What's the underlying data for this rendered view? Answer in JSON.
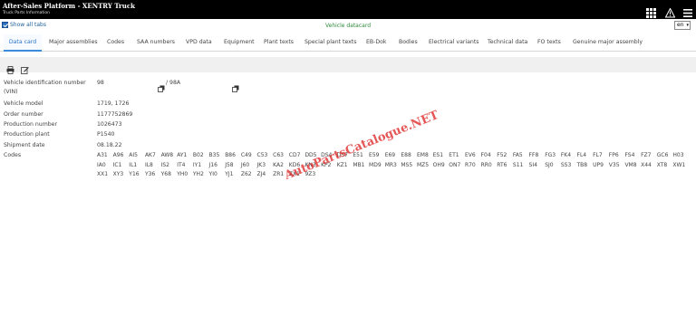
{
  "header": {
    "title": "After-Sales Platform - XENTRY Truck",
    "subtitle": "Truck Parts Information",
    "icons": [
      "grid-icon",
      "warning-icon",
      "menu-icon"
    ]
  },
  "subbar": {
    "show_all_tabs": "Show all tabs",
    "center_title": "Vehicle datacard",
    "language": "en"
  },
  "tabs": [
    {
      "label": "Data card",
      "active": true
    },
    {
      "label": "Major assemblies"
    },
    {
      "label": "Codes"
    },
    {
      "label": "SAA numbers"
    },
    {
      "label": "VPD data"
    },
    {
      "label": "Equipment"
    },
    {
      "label": "Plant texts"
    },
    {
      "label": "Special plant texts"
    },
    {
      "label": "EB-Dok"
    },
    {
      "label": "Bodies"
    },
    {
      "label": "Electrical variants"
    },
    {
      "label": "Technical data"
    },
    {
      "label": "FO texts"
    },
    {
      "label": "Genuine major assembly"
    }
  ],
  "toolbar": {
    "icons": [
      "print-icon",
      "edit-icon"
    ]
  },
  "details": {
    "vin_label_1": "Vehicle identification number",
    "vin_label_2": "(VIN)",
    "vin_value": "98",
    "vin_value_2": "/ 98A",
    "model_label": "Vehicle model",
    "model_value": "1719, 1726",
    "order_label": "Order number",
    "order_value": "1177752869",
    "prodnum_label": "Production number",
    "prodnum_value": "1026473",
    "plant_label": "Production plant",
    "plant_value": "P1540",
    "ship_label": "Shipment date",
    "ship_value": "08.18.22",
    "codes_label": "Codes"
  },
  "codes": [
    [
      "A31",
      "A96",
      "AI5",
      "AK7",
      "AW8",
      "AY1",
      "B02",
      "B35",
      "B86",
      "C49",
      "C53",
      "C63",
      "CD7",
      "DD5",
      "DS4",
      "DS7",
      "E51",
      "E59",
      "E69",
      "E88",
      "EM8",
      "ES1",
      "ET1",
      "EV6",
      "F04",
      "F52",
      "FA5",
      "FF8",
      "FG3",
      "FK4",
      "FL4",
      "FL7",
      "FP6",
      "FS4",
      "FZ7",
      "GC6",
      "H03"
    ],
    [
      "IA0",
      "IC1",
      "IL1",
      "IL8",
      "IS2",
      "IT4",
      "IY1",
      "J16",
      "J58",
      "J60",
      "JK3",
      "KA2",
      "KD6",
      "KN3",
      "KP2",
      "KZ1",
      "MB1",
      "MD9",
      "MR3",
      "MS5",
      "MZ5",
      "OH9",
      "ON7",
      "R70",
      "RR0",
      "RT6",
      "S11",
      "SI4",
      "SJ0",
      "SS3",
      "TB8",
      "UP9",
      "V35",
      "VM8",
      "X44",
      "XT8",
      "XW1"
    ],
    [
      "XX1",
      "XY3",
      "Y16",
      "Y36",
      "Y68",
      "YH0",
      "YH2",
      "YI0",
      "YJ1",
      "Z62",
      "ZJ4",
      "ZR1",
      "ZX1",
      "9Z3"
    ]
  ],
  "watermark": "AutoPartsCatalogue.NET"
}
